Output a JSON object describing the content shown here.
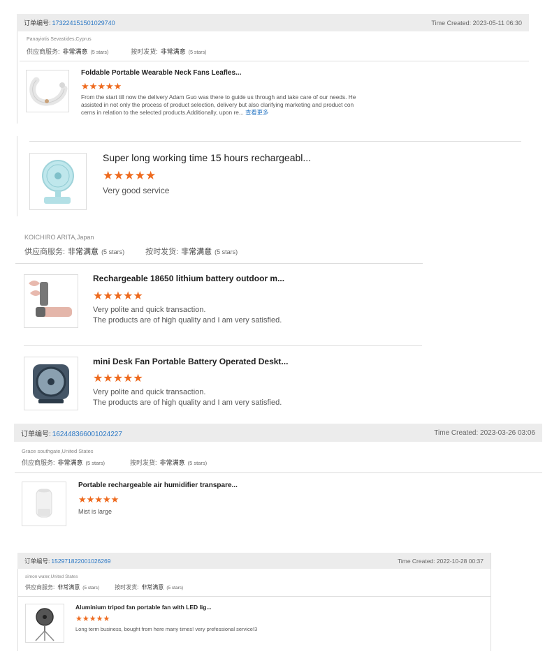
{
  "orders": [
    {
      "order_label": "订单编号:",
      "order_id": "173224151501029740",
      "time_created": "Time Created: 2023-05-11 06:30",
      "buyer": "Panayiotis Sevastides,Cyprus",
      "supplier_label": "供应商服务:",
      "supplier_value": "非常满意",
      "supplier_stars": "(5 stars)",
      "ontime_label": "按时发货:",
      "ontime_value": "非常满意",
      "ontime_stars": "(5 stars)",
      "items": [
        {
          "title": "Foldable Portable Wearable Neck Fans Leafles...",
          "rating": 5,
          "review_lines": [
            "From the start till now the delivery Adam Guo was there to guide us through and take care of our needs. He",
            "assisted in not only the process of product selection, delivery but also clarifying marketing and product con",
            "cerns in relation to the selected products.Additionally, upon re..."
          ],
          "more_label": "查看更多"
        },
        {
          "title": "Super long working time 15 hours rechargeabl...",
          "rating": 5,
          "review_lines": [
            "Very good service"
          ]
        }
      ]
    },
    {
      "buyer": "KOICHIRO ARITA,Japan",
      "supplier_label": "供应商服务:",
      "supplier_value": "非常满意",
      "supplier_stars": "(5 stars)",
      "ontime_label": "按时发货:",
      "ontime_value": "非常满意",
      "ontime_stars": "(5 stars)",
      "items": [
        {
          "title": "Rechargeable 18650 lithium battery outdoor m...",
          "rating": 5,
          "review_lines": [
            "Very polite and quick transaction.",
            "The products are of high quality and I am very satisfied."
          ]
        },
        {
          "title": "mini Desk Fan Portable Battery Operated Deskt...",
          "rating": 5,
          "review_lines": [
            "Very polite and quick transaction.",
            "The products are of high quality and I am very satisfied."
          ]
        }
      ]
    },
    {
      "order_label": "订单编号:",
      "order_id": "162448366001024227",
      "time_created": "Time Created: 2023-03-26 03:06",
      "buyer": "Grace southgate,United States",
      "supplier_label": "供应商服务:",
      "supplier_value": "非常满意",
      "supplier_stars": "(5 stars)",
      "ontime_label": "按时发货:",
      "ontime_value": "非常满意",
      "ontime_stars": "(5 stars)",
      "items": [
        {
          "title": "Portable rechargeable air humidifier transpare...",
          "rating": 5,
          "review_lines": [
            "Mist is large"
          ]
        }
      ]
    },
    {
      "order_label": "订单编号:",
      "order_id": "152971822001026269",
      "time_created": "Time Created: 2022-10-28 00:37",
      "buyer": "simon water,United States",
      "supplier_label": "供应商服务:",
      "supplier_value": "非常满意",
      "supplier_stars": "(5 stars)",
      "ontime_label": "按时发货:",
      "ontime_value": "非常满意",
      "ontime_stars": "(5 stars)",
      "items": [
        {
          "title": "Aluminium tripod fan portable fan with LED lig...",
          "rating": 5,
          "review_lines": [
            "Long term business, bought from here many times! very prefessional service!3"
          ]
        }
      ]
    }
  ],
  "colors": {
    "star": "#ee6a1e",
    "link": "#2b78c5",
    "header_bg": "#ececec"
  },
  "icons": [
    "neck-fan-icon",
    "clip-fan-icon",
    "handheld-fan-icon",
    "desk-fan-icon",
    "humidifier-icon",
    "tripod-fan-icon"
  ]
}
